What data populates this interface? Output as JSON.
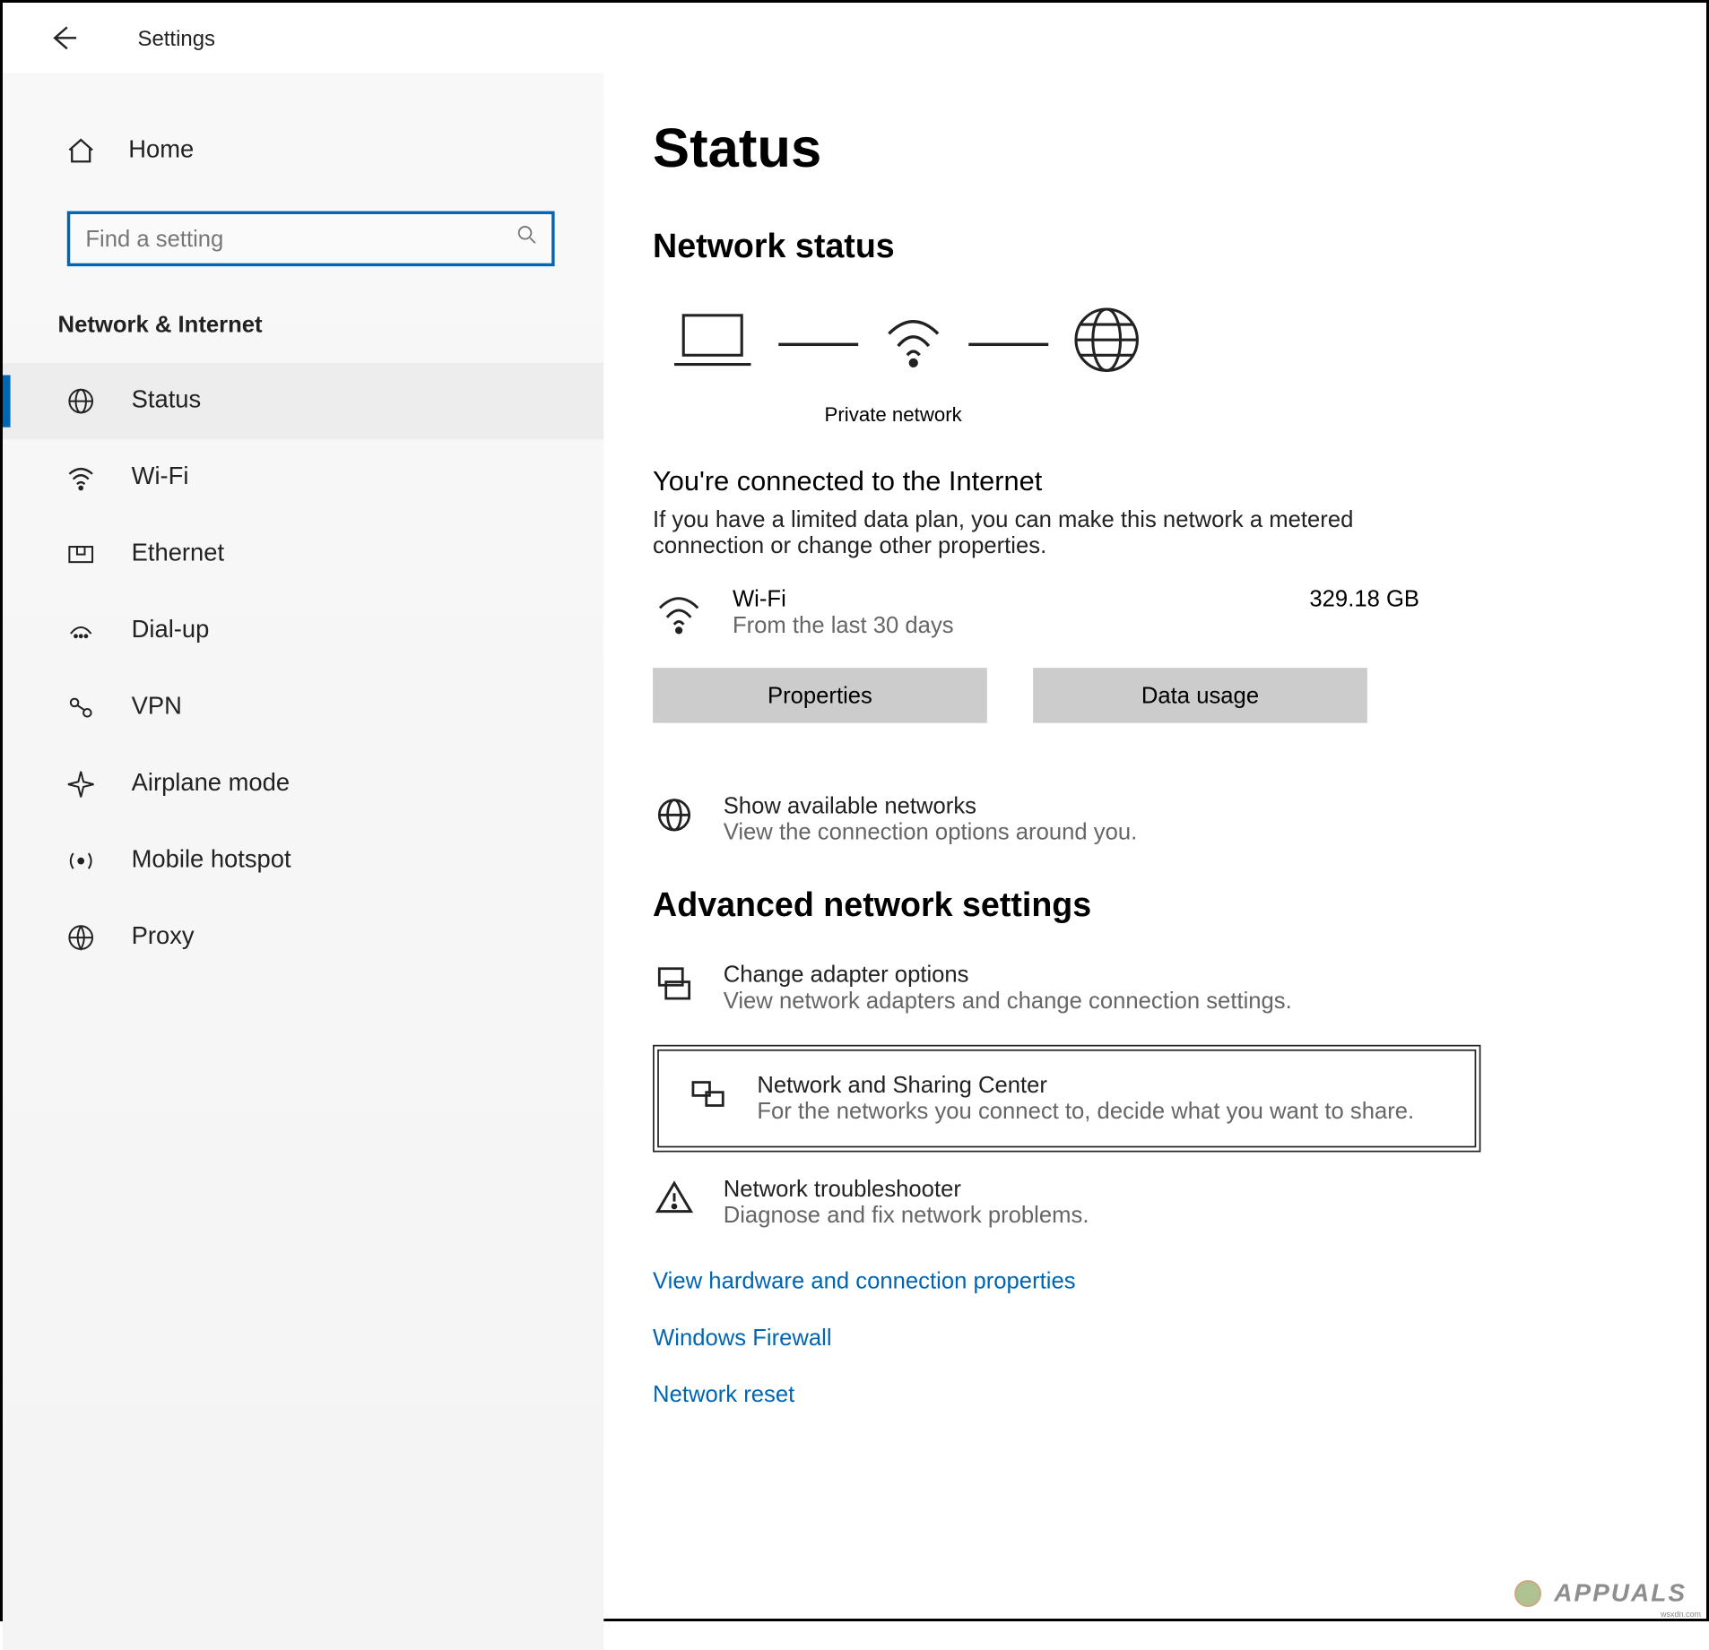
{
  "app": {
    "title": "Settings"
  },
  "sidebar": {
    "home_label": "Home",
    "search_placeholder": "Find a setting",
    "section_title": "Network & Internet",
    "items": [
      {
        "label": "Status",
        "selected": true
      },
      {
        "label": "Wi-Fi"
      },
      {
        "label": "Ethernet"
      },
      {
        "label": "Dial-up"
      },
      {
        "label": "VPN"
      },
      {
        "label": "Airplane mode"
      },
      {
        "label": "Mobile hotspot"
      },
      {
        "label": "Proxy"
      }
    ]
  },
  "main": {
    "page_title": "Status",
    "network_status_heading": "Network status",
    "private_network_label": "Private network",
    "connected_title": "You're connected to the Internet",
    "connected_desc": "If you have a limited data plan, you can make this network a metered connection or change other properties.",
    "usage": {
      "name": "Wi-Fi",
      "period": "From the last 30 days",
      "amount": "329.18 GB"
    },
    "buttons": {
      "properties": "Properties",
      "data_usage": "Data usage"
    },
    "show_networks": {
      "title": "Show available networks",
      "sub": "View the connection options around you."
    },
    "advanced_heading": "Advanced network settings",
    "adapter": {
      "title": "Change adapter options",
      "sub": "View network adapters and change connection settings."
    },
    "sharing": {
      "title": "Network and Sharing Center",
      "sub": "For the networks you connect to, decide what you want to share."
    },
    "troubleshooter": {
      "title": "Network troubleshooter",
      "sub": "Diagnose and fix network problems."
    },
    "links": {
      "hardware": "View hardware and connection properties",
      "firewall": "Windows Firewall",
      "reset": "Network reset"
    }
  },
  "watermark": "APPUALS",
  "source_text": "wsxdn.com"
}
